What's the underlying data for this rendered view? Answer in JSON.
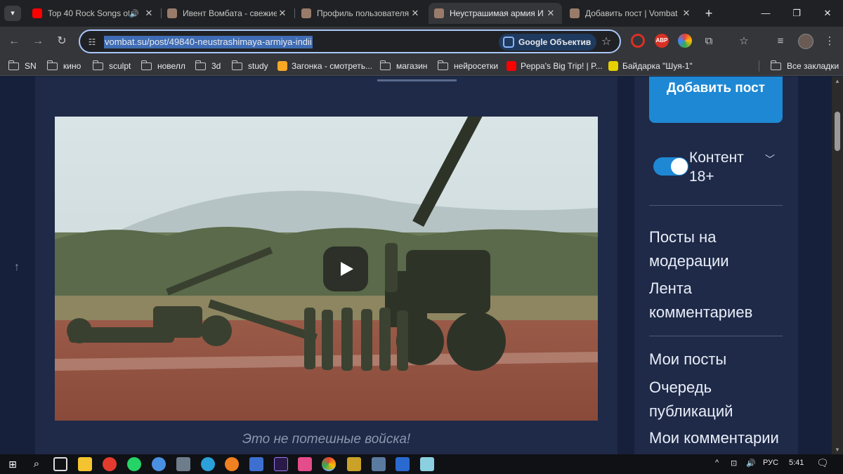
{
  "tabs": [
    {
      "title": "Top 40 Rock Songs of",
      "favicon_color": "#ff0000",
      "sound": true,
      "active": false
    },
    {
      "title": "Ивент Вомбата - свежие",
      "favicon_color": "#9a7b6a",
      "sound": false,
      "active": false
    },
    {
      "title": "Профиль пользователя",
      "favicon_color": "#9a7b6a",
      "sound": false,
      "active": false
    },
    {
      "title": "Неустрашимая армия И",
      "favicon_color": "#9a7b6a",
      "sound": false,
      "active": true
    },
    {
      "title": "Добавить пост | Vombat",
      "favicon_color": "#9a7b6a",
      "sound": false,
      "active": false
    }
  ],
  "omnibox": {
    "url": "vombat.su/post/49840-neustrashimaya-armiya-indii",
    "lens_label": "Google Объектив"
  },
  "extensions": [
    {
      "name": "red-circle-extension",
      "label": "",
      "color": "#d93025"
    },
    {
      "name": "adblock-extension",
      "label": "ABP",
      "color": "#d93025"
    },
    {
      "name": "color-extension",
      "label": "",
      "color": "#34a853"
    }
  ],
  "bookmarks": [
    {
      "label": "SN",
      "type": "folder"
    },
    {
      "label": "кино",
      "type": "folder"
    },
    {
      "label": "sculpt",
      "type": "folder"
    },
    {
      "label": "новелл",
      "type": "folder"
    },
    {
      "label": "3d",
      "type": "folder"
    },
    {
      "label": "study",
      "type": "folder"
    },
    {
      "label": "Загонка - смотреть...",
      "type": "site",
      "color": "#f9a825"
    },
    {
      "label": "магазин",
      "type": "folder"
    },
    {
      "label": "нейросетки",
      "type": "folder"
    },
    {
      "label": "Peppa's Big Trip! | P...",
      "type": "site",
      "color": "#ff0000"
    },
    {
      "label": "Байдарка \"Шуя-1\"",
      "type": "site",
      "color": "#e6d000"
    }
  ],
  "all_bookmarks_label": "Все закладки",
  "post": {
    "caption": "Это не потешные войска!"
  },
  "sidebar": {
    "add_post_label": "Добавить пост",
    "adult_content_label": "Контент 18+",
    "adult_content_enabled": true,
    "links_group1": [
      "Посты на модерации",
      "Лента комментариев"
    ],
    "links_group2": [
      "Мои посты",
      "Очередь публикаций",
      "Мои комментарии"
    ]
  },
  "taskbar": {
    "lang": "РУС",
    "time": "5:41"
  }
}
